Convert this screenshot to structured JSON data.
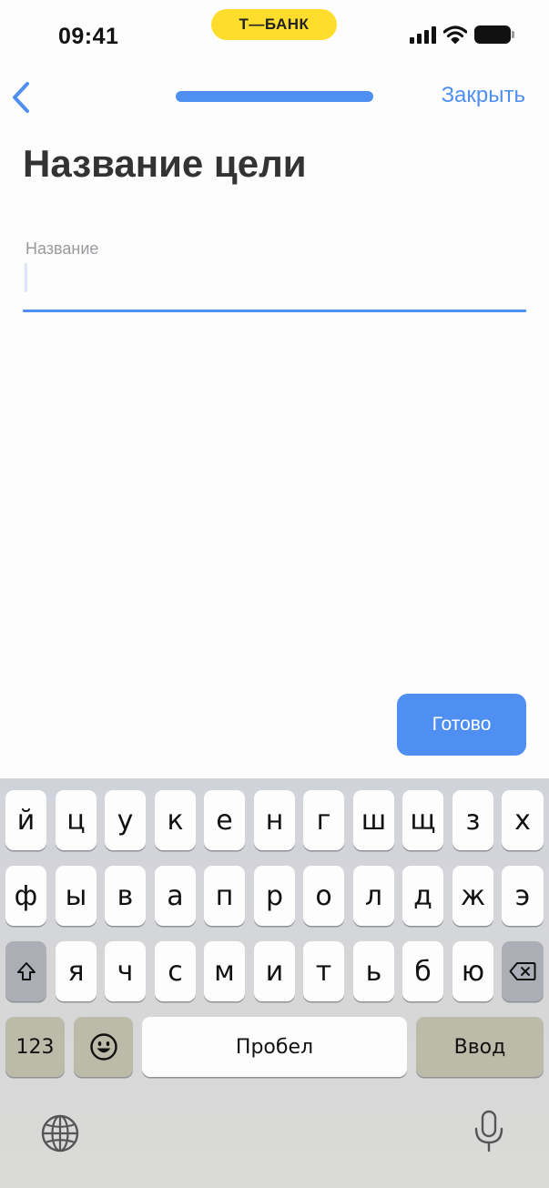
{
  "status_bar": {
    "time": "09:41",
    "brand": "Т—БАНК",
    "brand_color": "#ffdd2d",
    "icons": [
      "cellular-signal-icon",
      "wifi-icon",
      "battery-icon"
    ]
  },
  "nav": {
    "back_icon": "chevron-left-icon",
    "close_label": "Закрыть",
    "accent_color": "#4f8ff2",
    "progress": 1.0
  },
  "page": {
    "title": "Название цели"
  },
  "goal_name_field": {
    "label": "Название",
    "value": "",
    "placeholder": ""
  },
  "done_button": {
    "label": "Готово"
  },
  "keyboard": {
    "row1": [
      "й",
      "ц",
      "у",
      "к",
      "е",
      "н",
      "г",
      "ш",
      "щ",
      "з",
      "х"
    ],
    "row2": [
      "ф",
      "ы",
      "в",
      "а",
      "п",
      "р",
      "о",
      "л",
      "д",
      "ж",
      "э"
    ],
    "row3": [
      "я",
      "ч",
      "с",
      "м",
      "и",
      "т",
      "ь",
      "б",
      "ю"
    ],
    "shift_icon": "shift-icon",
    "backspace_icon": "backspace-icon",
    "numbers_label": "123",
    "emoji_icon": "emoji-icon",
    "space_label": "Пробел",
    "return_label": "Ввод",
    "globe_icon": "globe-icon",
    "mic_icon": "microphone-icon"
  }
}
